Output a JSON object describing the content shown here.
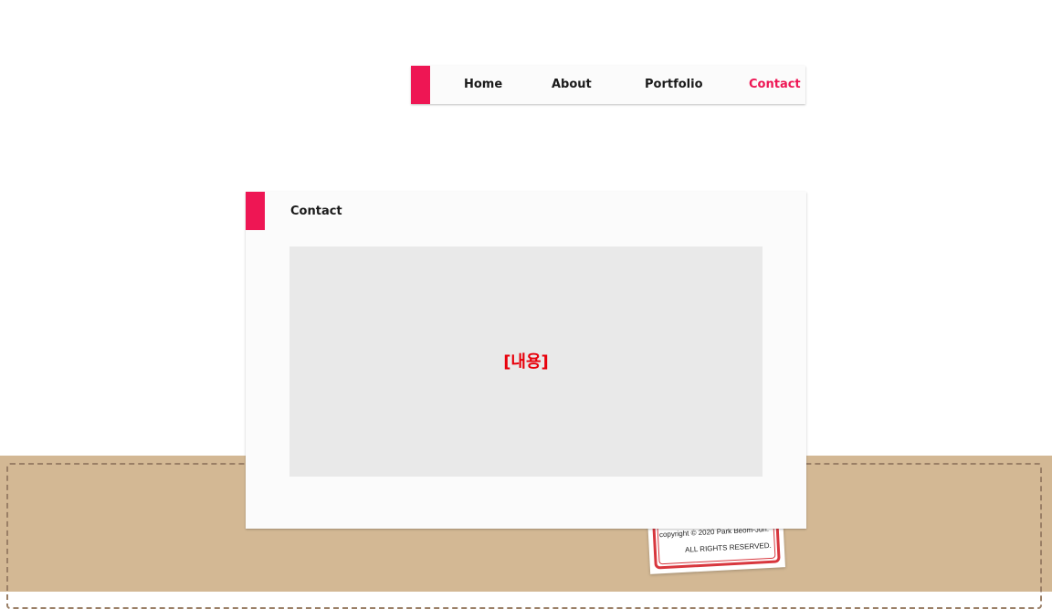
{
  "nav": {
    "items": [
      {
        "label": "Home"
      },
      {
        "label": "About"
      },
      {
        "label": "Portfolio"
      },
      {
        "label": "Contact"
      }
    ],
    "active": "Contact"
  },
  "panel": {
    "title": "Contact",
    "placeholder": "[내용]"
  },
  "footer": {
    "copyright": "copyright © 2020 Park Beom-Jun.",
    "rights": "ALL RIGHTS RESERVED."
  },
  "colors": {
    "accent": "#ee1654",
    "placeholder_text": "#e8000b",
    "desk": "#d3b894",
    "stamp_border": "#d8373e"
  }
}
